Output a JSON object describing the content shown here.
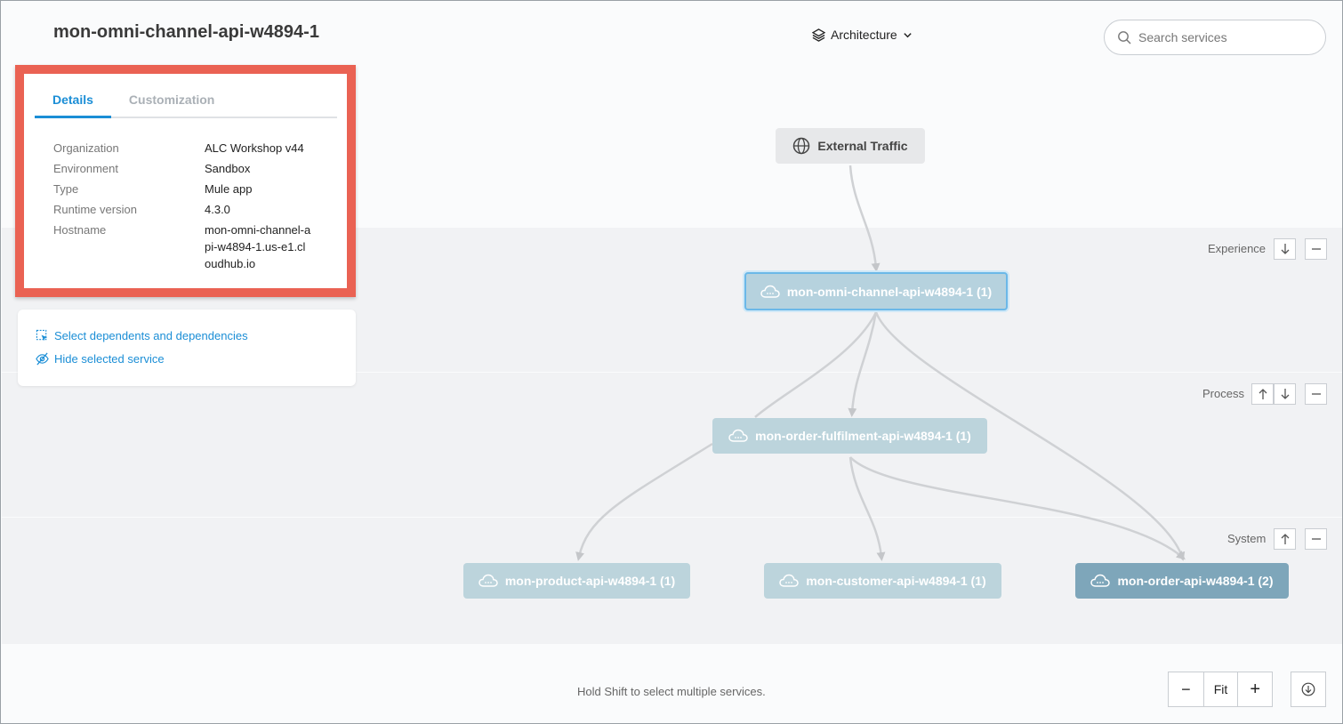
{
  "header": {
    "title": "mon-omni-channel-api-w4894-1",
    "view_select_label": "Architecture",
    "search_placeholder": "Search services"
  },
  "details_panel": {
    "tabs": [
      {
        "label": "Details",
        "active": true
      },
      {
        "label": "Customization",
        "active": false
      }
    ],
    "rows": [
      {
        "key": "Organization",
        "value": "ALC Workshop v44"
      },
      {
        "key": "Environment",
        "value": "Sandbox"
      },
      {
        "key": "Type",
        "value": "Mule app"
      },
      {
        "key": "Runtime version",
        "value": "4.3.0"
      },
      {
        "key": "Hostname",
        "value": "mon-omni-channel-api-w4894-1.us-e1.cloudhub.io"
      }
    ],
    "highlight_color": "#ea6253"
  },
  "actions": {
    "select_dependents": "Select dependents and dependencies",
    "hide_selected": "Hide selected service"
  },
  "layers": {
    "experience": "Experience",
    "process": "Process",
    "system": "System"
  },
  "nodes": {
    "external": "External Traffic",
    "omni": "mon-omni-channel-api-w4894-1 (1)",
    "fulfilment": "mon-order-fulfilment-api-w4894-1 (1)",
    "product": "mon-product-api-w4894-1 (1)",
    "customer": "mon-customer-api-w4894-1 (1)",
    "order": "mon-order-api-w4894-1 (2)"
  },
  "footer": {
    "hint": "Hold Shift to select multiple services.",
    "zoom_out": "−",
    "fit": "Fit",
    "zoom_in": "+"
  },
  "colors": {
    "accent": "#1b8ed6",
    "node_default": "#bcd4dc",
    "node_selected_border": "#6bb8e8",
    "node_strong": "#7ea6ba"
  }
}
